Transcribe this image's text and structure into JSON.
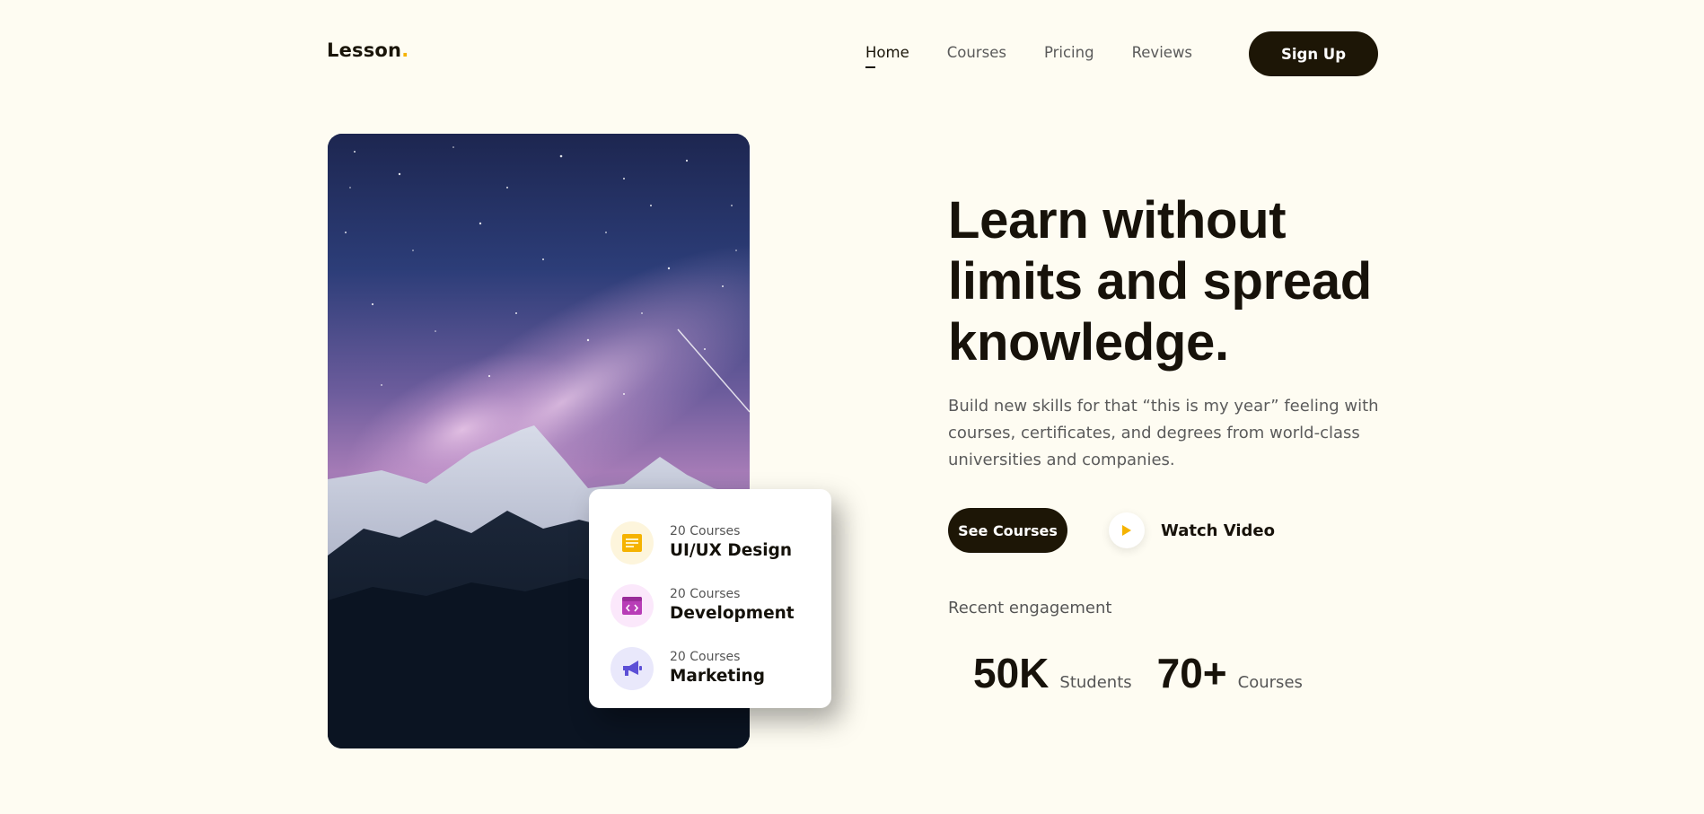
{
  "brand": {
    "name": "Lesson",
    "dot": ".",
    "accent_color": "#f5b301"
  },
  "nav": {
    "links": [
      {
        "label": "Home",
        "active": true
      },
      {
        "label": "Courses",
        "active": false
      },
      {
        "label": "Pricing",
        "active": false
      },
      {
        "label": "Reviews",
        "active": false
      }
    ],
    "signup_label": "Sign Up"
  },
  "hero": {
    "headline": "Learn without limits and spread knowledge.",
    "subtext": "Build new skills for that “this is my year” feeling with courses, certificates, and degrees from world-class universities and companies.",
    "primary_cta": "See Courses",
    "secondary_cta": "Watch Video",
    "engagement_label": "Recent engagement",
    "stats": [
      {
        "value": "50K",
        "label": "Students"
      },
      {
        "value": "70+",
        "label": "Courses"
      }
    ]
  },
  "categories": [
    {
      "count": "20 Courses",
      "name": "UI/UX Design",
      "icon": "layout-icon",
      "bg": "#fdf5dc",
      "color": "#f5b301"
    },
    {
      "count": "20 Courses",
      "name": "Development",
      "icon": "code-window-icon",
      "bg": "#fbe8fb",
      "color": "#b83db7"
    },
    {
      "count": "20 Courses",
      "name": "Marketing",
      "icon": "megaphone-icon",
      "bg": "#e9e8fb",
      "color": "#5c4fd6"
    }
  ],
  "colors": {
    "background": "#fefcf2",
    "dark_button": "#1d1606",
    "play_icon": "#f5b301"
  }
}
